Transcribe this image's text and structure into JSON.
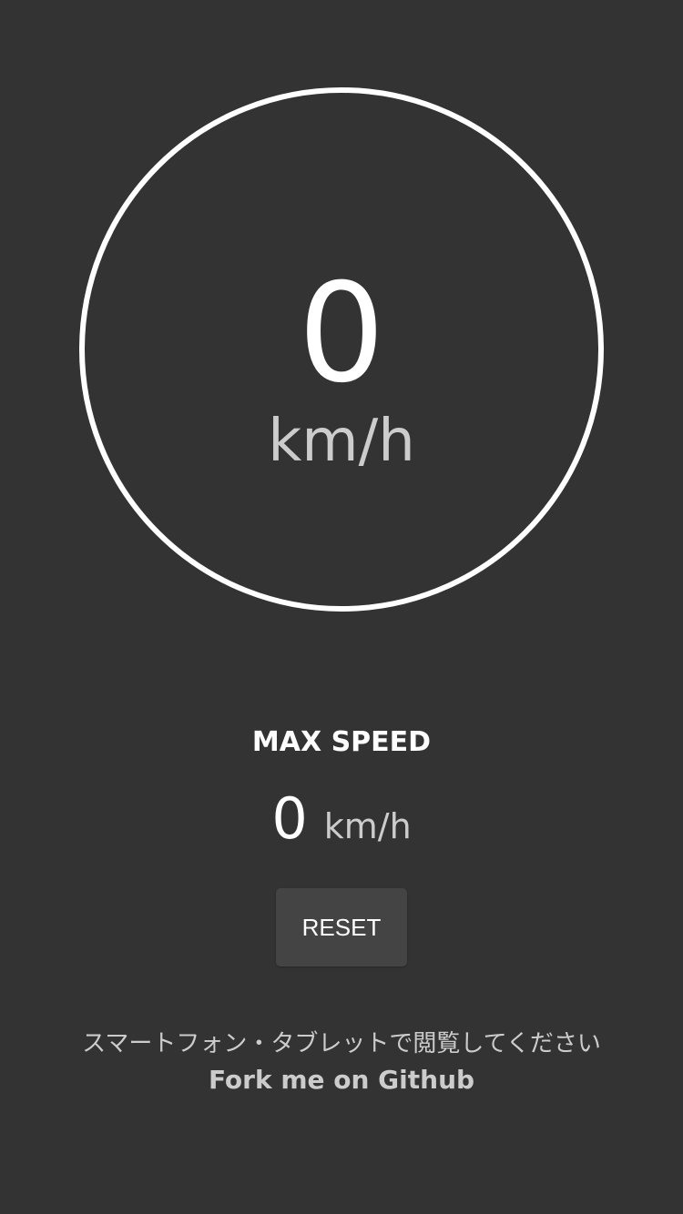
{
  "speedometer": {
    "speed": "0",
    "unit": "km/h"
  },
  "max_speed": {
    "title": "MAX SPEED",
    "value": "0",
    "unit": "km/h"
  },
  "controls": {
    "reset_label": "RESET"
  },
  "footer": {
    "note": "スマートフォン・タブレットで閲覧してください",
    "github_link": "Fork me on Github"
  },
  "colors": {
    "background": "#333333",
    "ring": "#ffffff",
    "primary_text": "#ffffff",
    "secondary_text": "#cccccc",
    "button_bg": "#444444"
  }
}
